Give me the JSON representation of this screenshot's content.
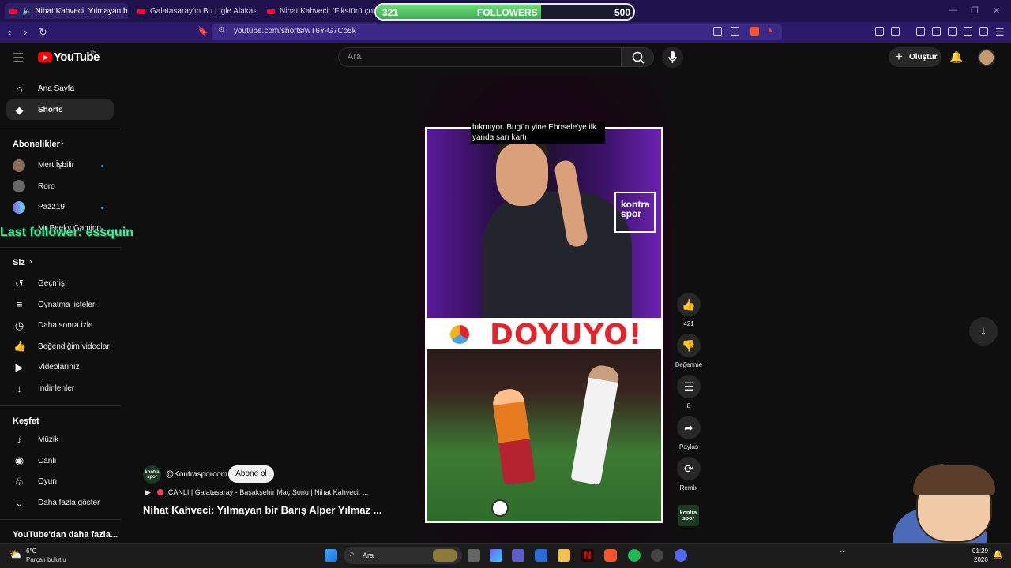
{
  "browser": {
    "tabs": [
      {
        "title": "Nihat Kahveci: Yılmayan bir B"
      },
      {
        "title": "Galatasaray'ın Bu Ligle Alakası Yok! |"
      },
      {
        "title": "Nihat Kahveci: 'Fikstürü çok zor, ac"
      }
    ],
    "url": "youtube.com/shorts/wT6Y-G7Co5k"
  },
  "overlay": {
    "followers_current": "321",
    "followers_label": "FOLLOWERS",
    "followers_goal": "500",
    "followers_progress": 0.642,
    "last_follower": "Last follower: essquin"
  },
  "header": {
    "logo_text": "YouTube",
    "logo_region": "TR",
    "search_placeholder": "Ara",
    "create_label": "Oluştur"
  },
  "sidebar": {
    "items": [
      {
        "label": "Ana Sayfa",
        "icon": "home-icon"
      },
      {
        "label": "Shorts",
        "icon": "shorts-icon"
      }
    ],
    "subscriptions_heading": "Abonelikler",
    "subscriptions": [
      {
        "name": "Mert İşbilir",
        "new": true
      },
      {
        "name": "Roro",
        "new": false
      },
      {
        "name": "Paz219",
        "new": true
      },
      {
        "name": "Mr Peeky Gaming",
        "new": true
      }
    ],
    "you_heading": "Siz",
    "you_items": [
      {
        "label": "Geçmiş",
        "icon": "history-icon"
      },
      {
        "label": "Oynatma listeleri",
        "icon": "playlist-icon"
      },
      {
        "label": "Daha sonra izle",
        "icon": "clock-icon"
      },
      {
        "label": "Beğendiğim videolar",
        "icon": "thumbs-up-icon"
      },
      {
        "label": "Videolarınız",
        "icon": "video-icon"
      },
      {
        "label": "İndirilenler",
        "icon": "download-icon"
      }
    ],
    "explore_heading": "Keşfet",
    "explore_items": [
      {
        "label": "Müzik",
        "icon": "music-icon"
      },
      {
        "label": "Canlı",
        "icon": "live-icon"
      },
      {
        "label": "Oyun",
        "icon": "gaming-icon"
      },
      {
        "label": "Daha fazla göster",
        "icon": "chevron-down-icon"
      }
    ],
    "more_heading": "YouTube'dan daha fazla..."
  },
  "video": {
    "caption": "bıkmıyor. Bugün yine Ebosele'ye ilk yanda sarı kartı",
    "banner_text": "DOYUYO!",
    "brand_logo": "kontra spor",
    "channel": "@Kontrasporcom",
    "subscribe_label": "Abone ol",
    "live_line": "CANLI | Galatasaray - Başakşehir Maç Sonu | Nihat Kahveci, ...",
    "title": "Nihat Kahveci: Yılmayan bir Barış Alper Yılmaz ..."
  },
  "actions": {
    "like_count": "421",
    "dislike_label": "Beğenme",
    "comment_count": "8",
    "share_label": "Paylaş",
    "remix_label": "Remix",
    "channel_thumb": "kontra spor"
  },
  "taskbar": {
    "temperature": "6°C",
    "weather": "Parçalı bulutlu",
    "search_label": "Ara",
    "time": "01:29",
    "date": "2026"
  },
  "colors": {
    "youtube_red": "#ff0000",
    "browser_chrome": "#2b1a6b",
    "follower_fill": "#4cc25f",
    "last_follower_text": "#53e39a",
    "banner_red": "#e3242b"
  }
}
